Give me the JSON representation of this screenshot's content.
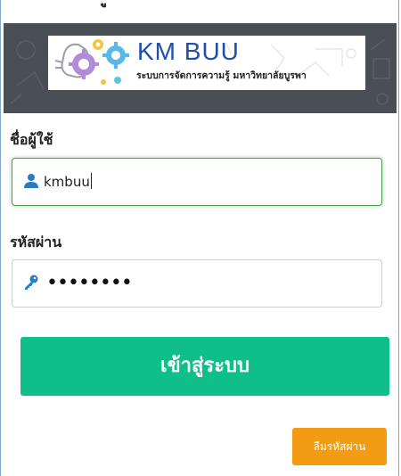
{
  "header": {
    "fragment": "ู"
  },
  "logo": {
    "title": "KM BUU",
    "subtitle": "ระบบการจัดการความรู้ มหาวิทยาลัยบูรพา"
  },
  "form": {
    "username_label": "ชื่อผู้ใช้",
    "username_value": "kmbuu",
    "password_label": "รหัสผ่าน",
    "password_masked": "••••••••",
    "login_button": "เข้าสู่ระบบ",
    "forgot_button": "ลืมรหัสผ่าน"
  },
  "colors": {
    "banner_bg": "#4a4e55",
    "logo_text": "#1f4fa6",
    "login_button": "#0fbf8a",
    "forgot_button": "#f39b12",
    "focus_border": "#4fa04f"
  },
  "icons": {
    "username": "user-icon",
    "password": "key-icon"
  }
}
